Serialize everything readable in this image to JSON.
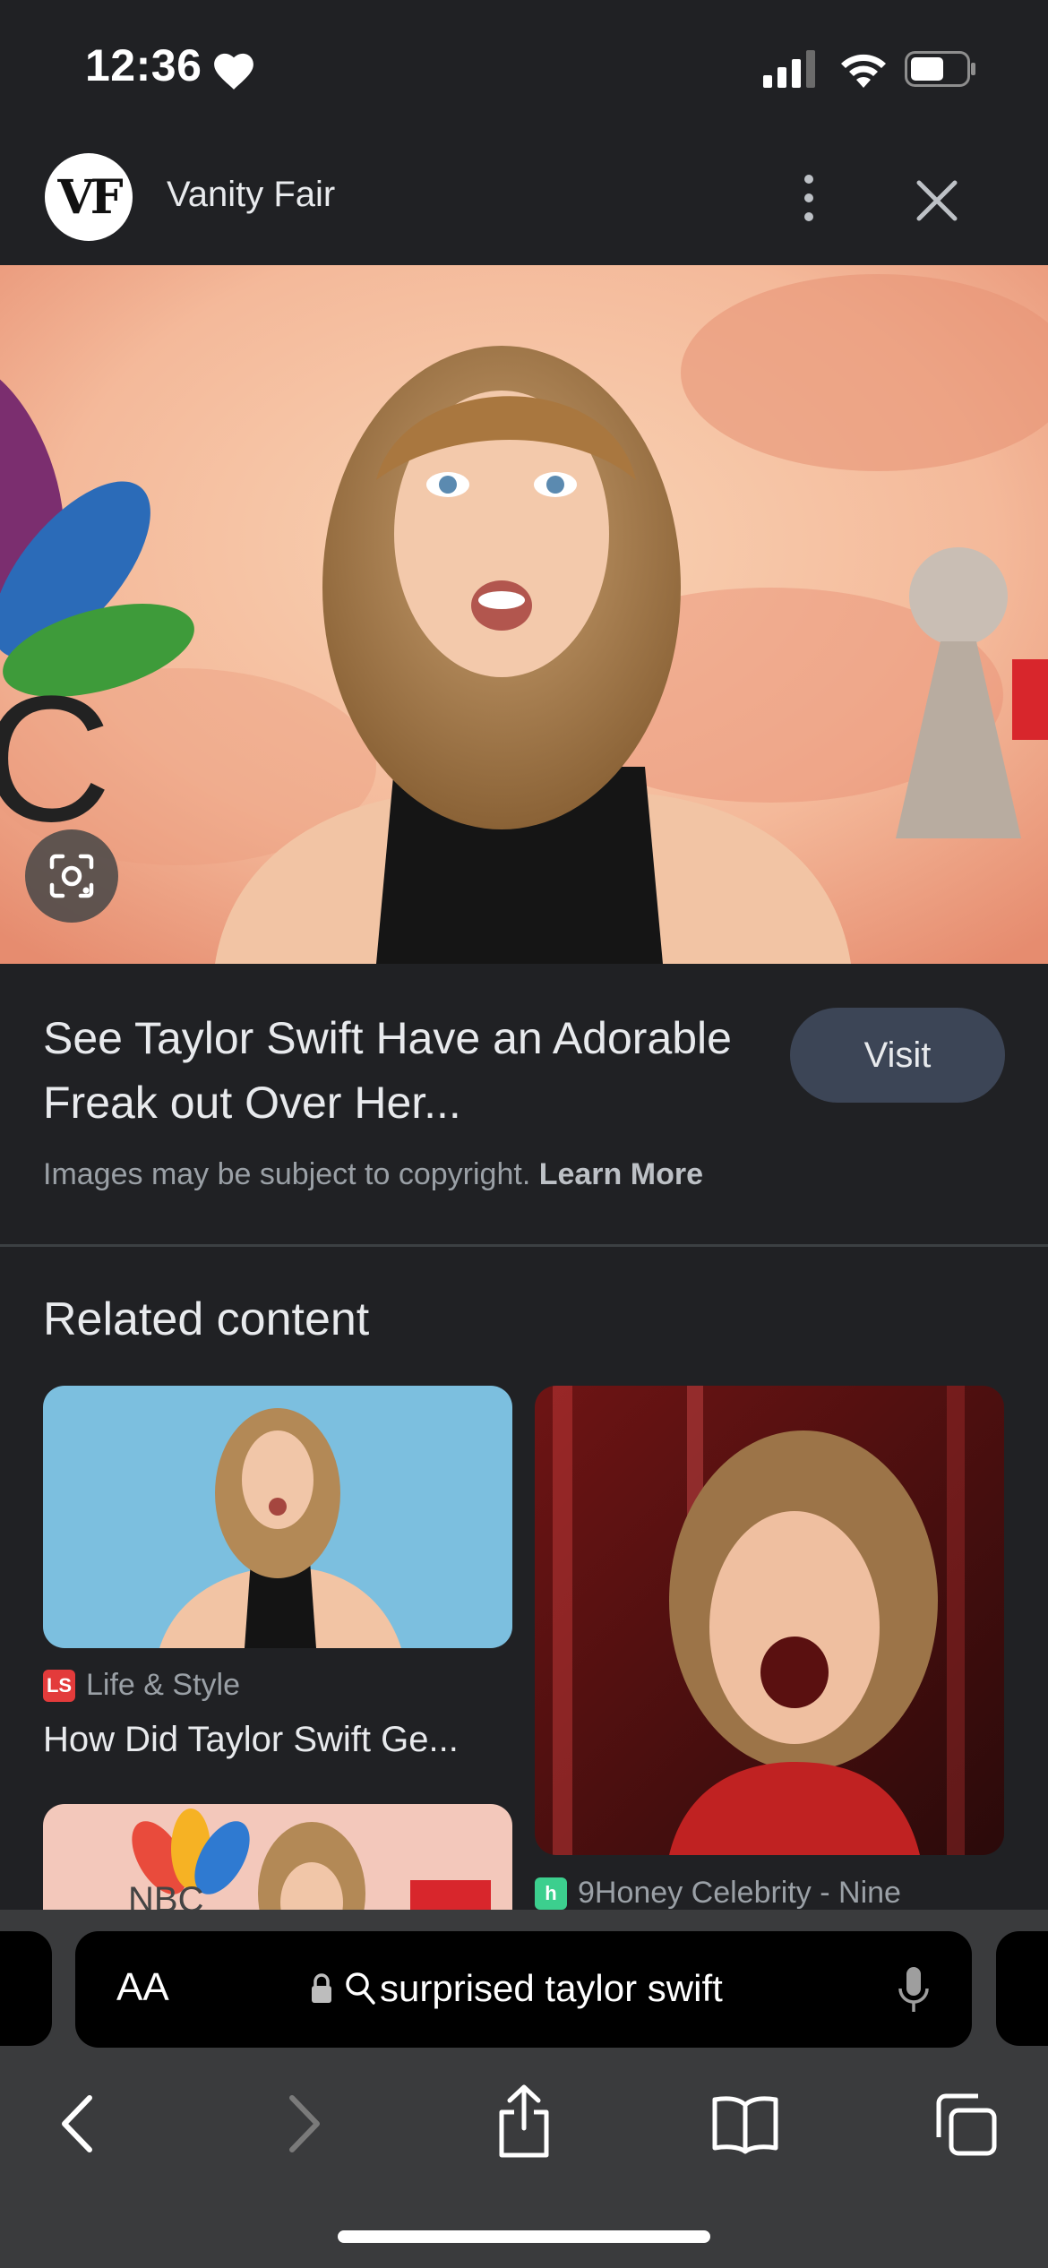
{
  "status_bar": {
    "time": "12:36"
  },
  "header": {
    "logo_text": "VF",
    "site_name": "Vanity Fair"
  },
  "result": {
    "title": "See Taylor Swift Have an Adorable Freak out Over Her...",
    "visit_label": "Visit",
    "copyright_text": "Images may be subject to copyright.",
    "learn_more_label": "Learn More"
  },
  "related": {
    "heading": "Related content",
    "cards": [
      {
        "source": "Life & Style",
        "source_badge": "LS",
        "title": "How Did Taylor Swift Ge..."
      },
      {
        "source": "9Honey Celebrity - Nine",
        "source_badge": "h",
        "title": ""
      }
    ]
  },
  "search_bar": {
    "text_size_label": "AA",
    "query": "surprised taylor swift"
  },
  "colors": {
    "background": "#202124",
    "visit_button": "#3c4556",
    "toolbar": "#3a3b3d"
  },
  "icons": [
    "heart-icon",
    "signal-icon",
    "wifi-icon",
    "battery-icon",
    "more-vert-icon",
    "close-icon",
    "lens-icon",
    "lock-icon",
    "search-icon",
    "microphone-icon",
    "back-icon",
    "forward-icon",
    "share-icon",
    "bookmarks-icon",
    "tabs-icon"
  ]
}
